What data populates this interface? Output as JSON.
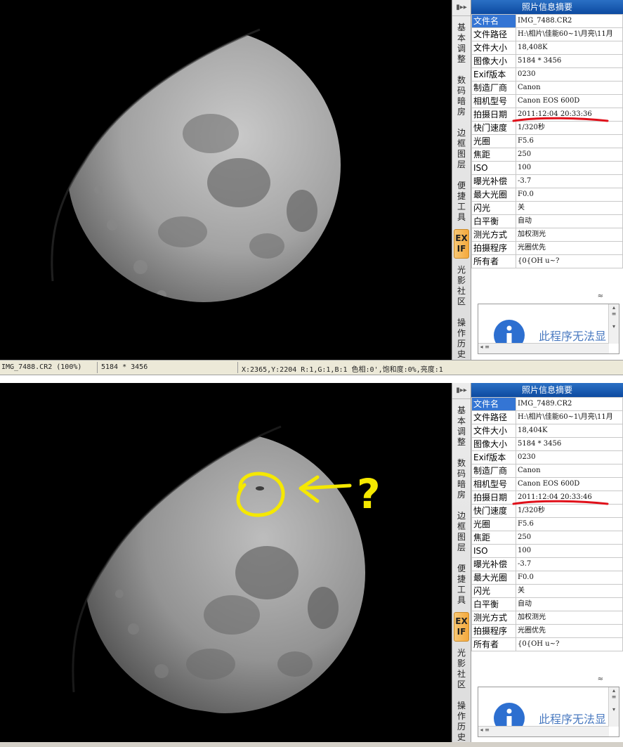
{
  "panel_title": "照片信息摘要",
  "tabs": [
    "基本调整",
    "数码暗房",
    "边框图层",
    "便捷工具",
    "EXIF",
    "光影社区",
    "操作历史"
  ],
  "top": {
    "exif": [
      {
        "key": "文件名",
        "value": "IMG_7488.CR2"
      },
      {
        "key": "文件路径",
        "value": "H:\\相片\\佳能60~1\\月亮\\11月"
      },
      {
        "key": "文件大小",
        "value": "18,408K"
      },
      {
        "key": "图像大小",
        "value": "5184 * 3456"
      },
      {
        "key": "Exif版本",
        "value": "0230"
      },
      {
        "key": "制造厂商",
        "value": "Canon"
      },
      {
        "key": "相机型号",
        "value": "Canon EOS 600D"
      },
      {
        "key": "拍摄日期",
        "value": "2011:12:04 20:33:36"
      },
      {
        "key": "快门速度",
        "value": "1/320秒"
      },
      {
        "key": "光圈",
        "value": "F5.6"
      },
      {
        "key": "焦距",
        "value": "250"
      },
      {
        "key": "ISO",
        "value": "100"
      },
      {
        "key": "曝光补偿",
        "value": "-3.7"
      },
      {
        "key": "最大光圈",
        "value": "F0.0"
      },
      {
        "key": "闪光",
        "value": "关"
      },
      {
        "key": "白平衡",
        "value": "自动"
      },
      {
        "key": "测光方式",
        "value": "加权测光"
      },
      {
        "key": "拍摄程序",
        "value": "光圈优先"
      },
      {
        "key": "所有者",
        "value": "  {0{OH u~?"
      }
    ],
    "notice": "此程序无法显",
    "status": {
      "file": "IMG_7488.CR2 (100%)",
      "size": "5184 * 3456",
      "pixel": "X:2365,Y:2204 R:1,G:1,B:1 色相:0',饱和度:0%,亮度:1"
    }
  },
  "bottom": {
    "exif": [
      {
        "key": "文件名",
        "value": "IMG_7489.CR2"
      },
      {
        "key": "文件路径",
        "value": "H:\\相片\\佳能60~1\\月亮\\11月"
      },
      {
        "key": "文件大小",
        "value": "18,404K"
      },
      {
        "key": "图像大小",
        "value": "5184 * 3456"
      },
      {
        "key": "Exif版本",
        "value": "0230"
      },
      {
        "key": "制造厂商",
        "value": "Canon"
      },
      {
        "key": "相机型号",
        "value": "Canon EOS 600D"
      },
      {
        "key": "拍摄日期",
        "value": "2011:12:04 20:33:46"
      },
      {
        "key": "快门速度",
        "value": "1/320秒"
      },
      {
        "key": "光圈",
        "value": "F5.6"
      },
      {
        "key": "焦距",
        "value": "250"
      },
      {
        "key": "ISO",
        "value": "100"
      },
      {
        "key": "曝光补偿",
        "value": "-3.7"
      },
      {
        "key": "最大光圈",
        "value": "F0.0"
      },
      {
        "key": "闪光",
        "value": "关"
      },
      {
        "key": "白平衡",
        "value": "自动"
      },
      {
        "key": "测光方式",
        "value": "加权测光"
      },
      {
        "key": "拍摄程序",
        "value": "光圈优先"
      },
      {
        "key": "所有者",
        "value": "  {0{OH u~?"
      }
    ],
    "notice": "此程序无法显",
    "annotation": "?"
  },
  "colors": {
    "header": "#0d4aa0",
    "selected_key": "#3475d4",
    "active_tab": "#f5a93c",
    "underline": "#e0101a",
    "annotation": "#f5e800"
  }
}
